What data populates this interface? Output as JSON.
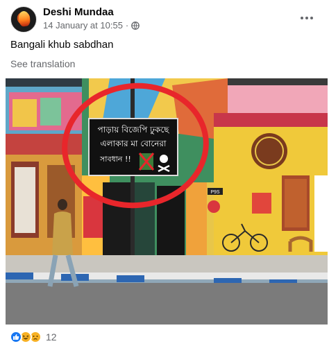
{
  "post": {
    "author": "Deshi Mundaa",
    "timestamp": "14 January at 10:55",
    "privacy_separator": "·",
    "caption": "Bangali khub sabdhan",
    "see_translation": "See translation",
    "more_icon": "more-horizontal-icon",
    "privacy_icon": "globe-icon"
  },
  "photo": {
    "sign_lines": [
      "পাড়ায় বিজেপি ঢুকছে",
      "এলাকার মা বোনেরা",
      "সাবধান !!"
    ],
    "wall_number": "P9S"
  },
  "reactions": {
    "icons": [
      "like-icon",
      "haha-icon",
      "sad-icon"
    ],
    "count": "12"
  },
  "colors": {
    "secondary_text": "#65676b",
    "circle_highlight": "#e8262b",
    "like_blue": "#1877f2"
  }
}
